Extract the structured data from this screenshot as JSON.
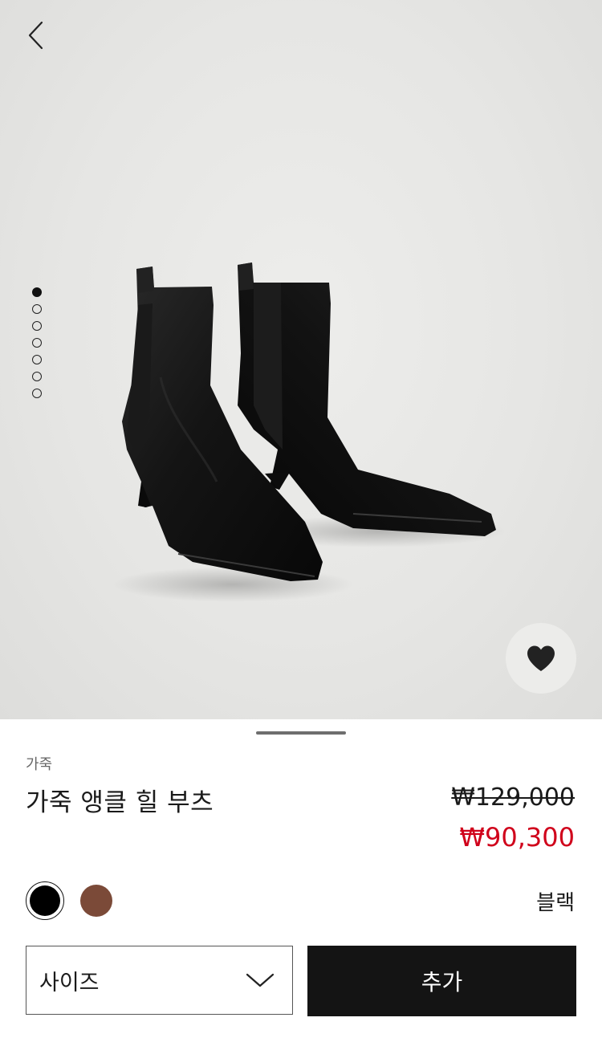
{
  "gallery": {
    "image_alt": "black leather ankle boots",
    "dot_count": 7,
    "active_dot_index": 0
  },
  "icons": {
    "back": "chevron-left-icon",
    "favorite": "heart-icon",
    "dropdown": "chevron-down-icon"
  },
  "product": {
    "category": "가죽",
    "name": "가죽 앵클 힐 부츠",
    "original_price": "₩129,000",
    "sale_price": "₩90,300"
  },
  "colors": {
    "options": [
      {
        "name": "black",
        "hex": "#000000",
        "selected": true
      },
      {
        "name": "brown",
        "hex": "#7b4a38",
        "selected": false
      }
    ],
    "selected_label": "블랙"
  },
  "actions": {
    "size_label": "사이즈",
    "add_label": "추가"
  },
  "theme": {
    "sale_color": "#d0021b",
    "button_bg": "#141414"
  }
}
